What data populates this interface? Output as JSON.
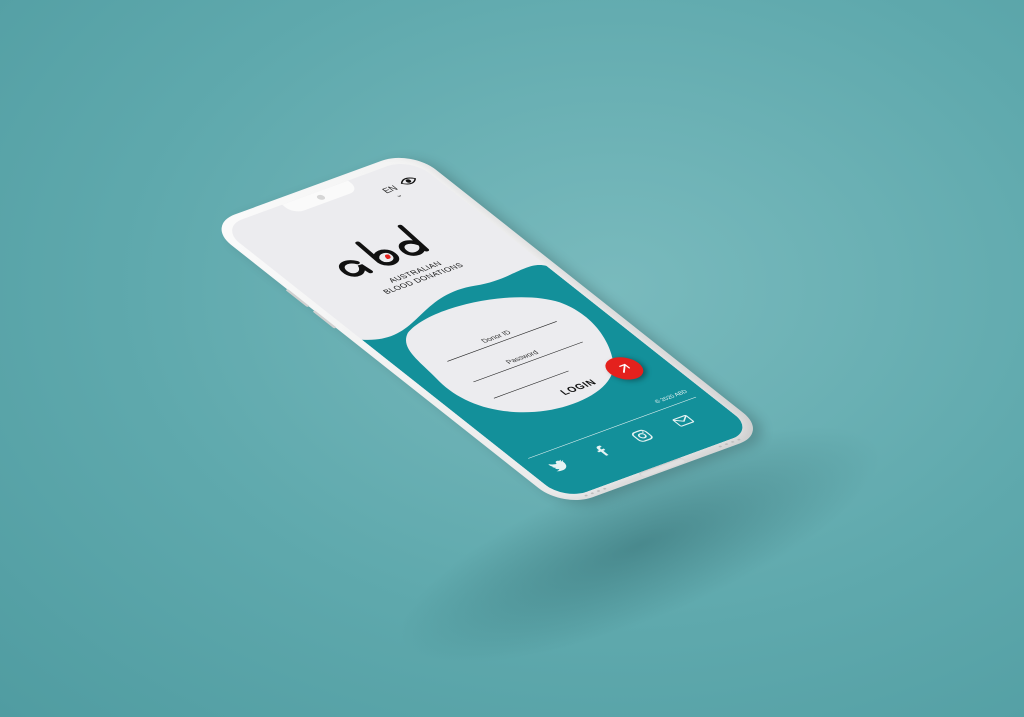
{
  "header": {
    "language": "EN",
    "language_chevron": "⌄",
    "icon": "eye-icon"
  },
  "brand": {
    "logo_text": "abd",
    "tagline_line1": "AUSTRALIAN",
    "tagline_line2": "BLOOD DONATIONS"
  },
  "login": {
    "donor_id_label": "Donor ID",
    "password_label": "Password",
    "button_label": "LOGIN",
    "button_icon": "arrow-icon"
  },
  "footer": {
    "copyright": "© 2020 ABD",
    "social": [
      "twitter-icon",
      "facebook-icon",
      "instagram-icon",
      "mail-icon"
    ]
  },
  "colors": {
    "background": "#62aaae",
    "teal": "#13909a",
    "screen": "#ececef",
    "accent_red": "#e4211d"
  }
}
